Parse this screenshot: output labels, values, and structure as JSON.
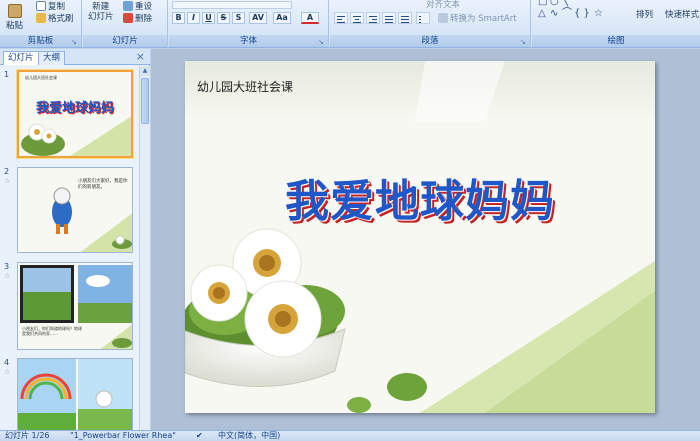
{
  "ribbon": {
    "clipboard": {
      "paste": "粘贴",
      "copy": "复制",
      "format_painter": "格式刷",
      "label": "剪贴板"
    },
    "slides": {
      "new_slide": "新建",
      "new_slide_line2": "幻灯片",
      "reset": "重设",
      "delete": "删除",
      "label": "幻灯片"
    },
    "font": {
      "label": "字体",
      "bold": "B",
      "italic": "I",
      "underline": "U",
      "strike": "S",
      "shadow": "S",
      "spacing": "AV",
      "case": "Aa",
      "color": "A"
    },
    "paragraph": {
      "label": "段落",
      "align_text": "对齐文本",
      "convert_smartart": "转换为 SmartArt"
    },
    "drawing": {
      "label": "绘图",
      "arrange": "排列",
      "quick_styles": "快速样式"
    }
  },
  "panel": {
    "tab_slides": "幻灯片",
    "tab_outline": "大纲",
    "close": "×",
    "thumbnails": [
      {
        "number": "1",
        "title": "我爱地球妈妈",
        "subtitle": "幼儿园大班社会课"
      },
      {
        "number": "2",
        "text": "小朋友们大家好，我是你们的新朋友。"
      },
      {
        "number": "3",
        "text": "小朋友们，你们知道地球吗？地球是我们共同的家……"
      },
      {
        "number": "4"
      }
    ]
  },
  "slide": {
    "subtitle": "幼儿园大班社会课",
    "title": "我爱地球妈妈"
  },
  "status": {
    "slide_indicator": "幻灯片 1/26",
    "theme": "\"1_Powerbar Flower Rhea\"",
    "language": "中文(简体，中国)"
  },
  "colors": {
    "title_blue": "#1f56c8",
    "title_shadow_red": "#d42a2a",
    "ribbon_bg": "#d7e6f7",
    "accent_green": "#c8dc9a"
  }
}
